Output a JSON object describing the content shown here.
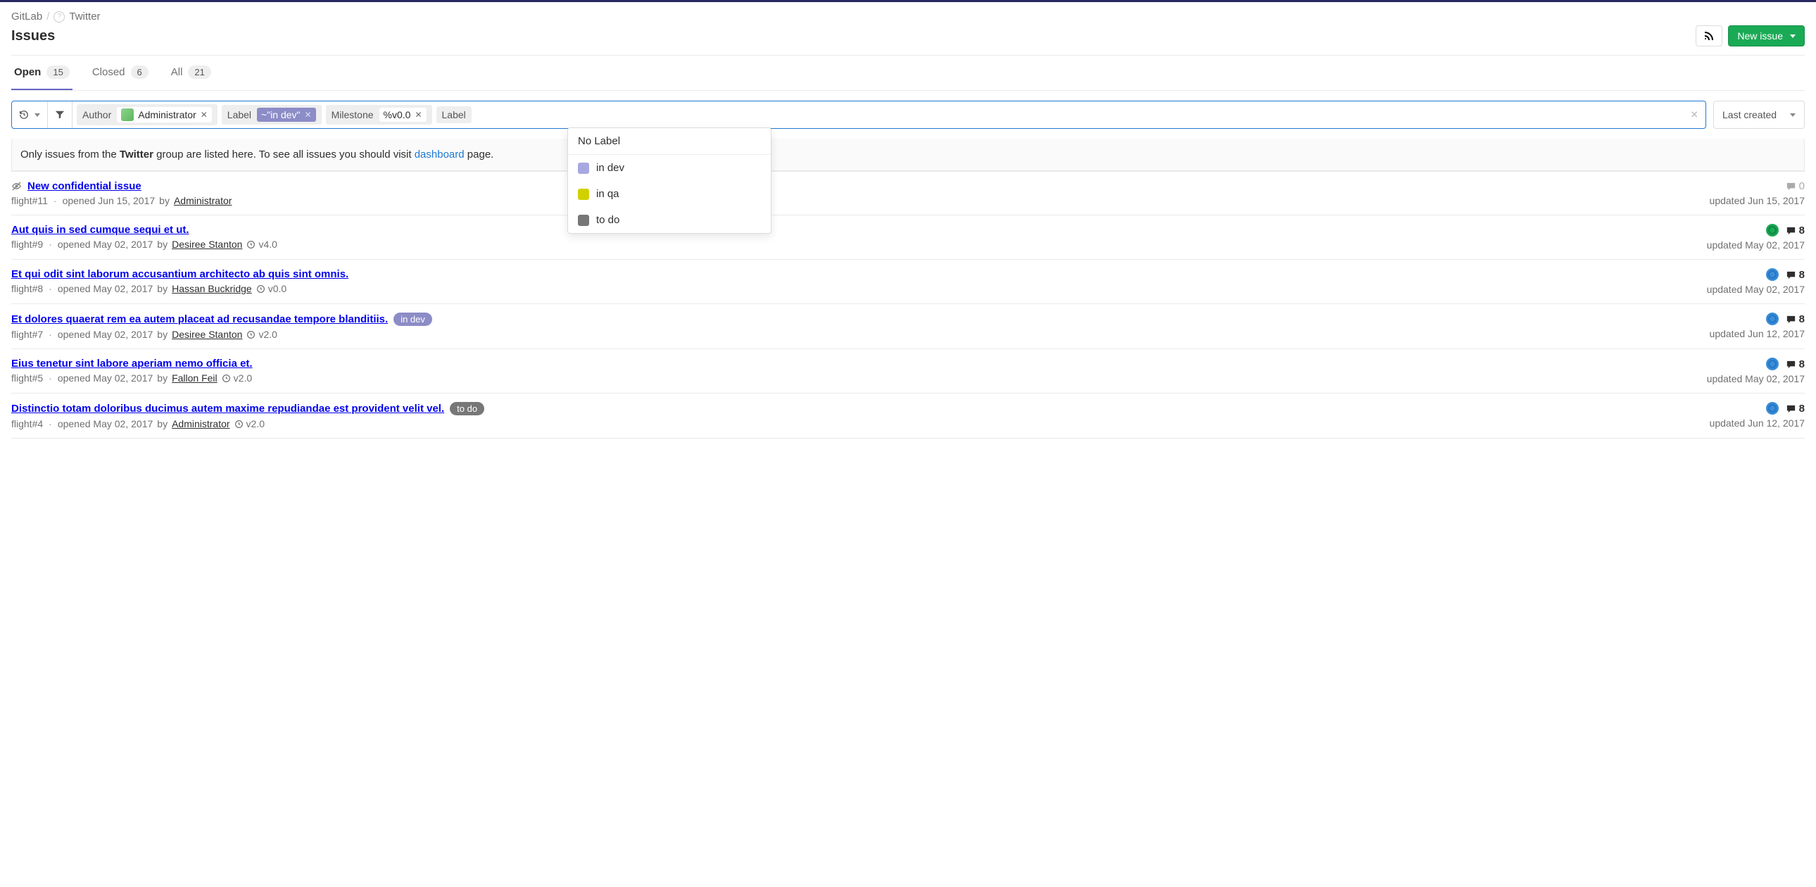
{
  "breadcrumbs": {
    "root": "GitLab",
    "group": "Twitter"
  },
  "page_title": "Issues",
  "actions": {
    "new_issue": "New issue"
  },
  "tabs": [
    {
      "label": "Open",
      "count": "15",
      "active": true
    },
    {
      "label": "Closed",
      "count": "6",
      "active": false
    },
    {
      "label": "All",
      "count": "21",
      "active": false
    }
  ],
  "filter": {
    "tokens": {
      "author_label": "Author",
      "author_value": "Administrator",
      "label_label": "Label",
      "label_value": "~\"in dev\"",
      "milestone_label": "Milestone",
      "milestone_value": "%v0.0",
      "label2_label": "Label"
    },
    "sort": "Last created"
  },
  "dropdown": {
    "no_label": "No Label",
    "items": [
      {
        "name": "in dev",
        "color": "#a8a8e0"
      },
      {
        "name": "in qa",
        "color": "#d1d100"
      },
      {
        "name": "to do",
        "color": "#777777"
      }
    ]
  },
  "notice": {
    "pre": "Only issues from the ",
    "group": "Twitter",
    "mid": " group are listed here. To see all issues you should visit ",
    "link": "dashboard",
    "post": " page."
  },
  "issues": [
    {
      "confidential": true,
      "title": "New confidential issue",
      "ref": "flight#11",
      "opened": "opened Jun 15, 2017",
      "by": "by",
      "author": "Administrator",
      "milestone": null,
      "labels": [],
      "assignee": null,
      "comments": "0",
      "comments_muted": true,
      "updated": "updated Jun 15, 2017"
    },
    {
      "confidential": false,
      "title": "Aut quis in sed cumque sequi et ut.",
      "ref": "flight#9",
      "opened": "opened May 02, 2017",
      "by": "by",
      "author": "Desiree Stanton",
      "milestone": "v4.0",
      "labels": [],
      "assignee": "g",
      "comments": "8",
      "comments_muted": false,
      "updated": "updated May 02, 2017"
    },
    {
      "confidential": false,
      "title": "Et qui odit sint laborum accusantium architecto ab quis sint omnis.",
      "ref": "flight#8",
      "opened": "opened May 02, 2017",
      "by": "by",
      "author": "Hassan Buckridge",
      "milestone": "v0.0",
      "labels": [],
      "assignee": "b",
      "comments": "8",
      "comments_muted": false,
      "updated": "updated May 02, 2017"
    },
    {
      "confidential": false,
      "title": "Et dolores quaerat rem ea autem placeat ad recusandae tempore blanditiis.",
      "ref": "flight#7",
      "opened": "opened May 02, 2017",
      "by": "by",
      "author": "Desiree Stanton",
      "milestone": "v2.0",
      "labels": [
        {
          "text": "in dev",
          "bg": "#8c8cc7"
        }
      ],
      "assignee": "b",
      "comments": "8",
      "comments_muted": false,
      "updated": "updated Jun 12, 2017"
    },
    {
      "confidential": false,
      "title": "Eius tenetur sint labore aperiam nemo officia et.",
      "ref": "flight#5",
      "opened": "opened May 02, 2017",
      "by": "by",
      "author": "Fallon Feil",
      "milestone": "v2.0",
      "labels": [],
      "assignee": "b",
      "comments": "8",
      "comments_muted": false,
      "updated": "updated May 02, 2017"
    },
    {
      "confidential": false,
      "title": "Distinctio totam doloribus ducimus autem maxime repudiandae est provident velit vel.",
      "ref": "flight#4",
      "opened": "opened May 02, 2017",
      "by": "by",
      "author": "Administrator",
      "milestone": "v2.0",
      "labels": [
        {
          "text": "to do",
          "bg": "#777777"
        }
      ],
      "assignee": "b",
      "comments": "8",
      "comments_muted": false,
      "updated": "updated Jun 12, 2017"
    }
  ]
}
